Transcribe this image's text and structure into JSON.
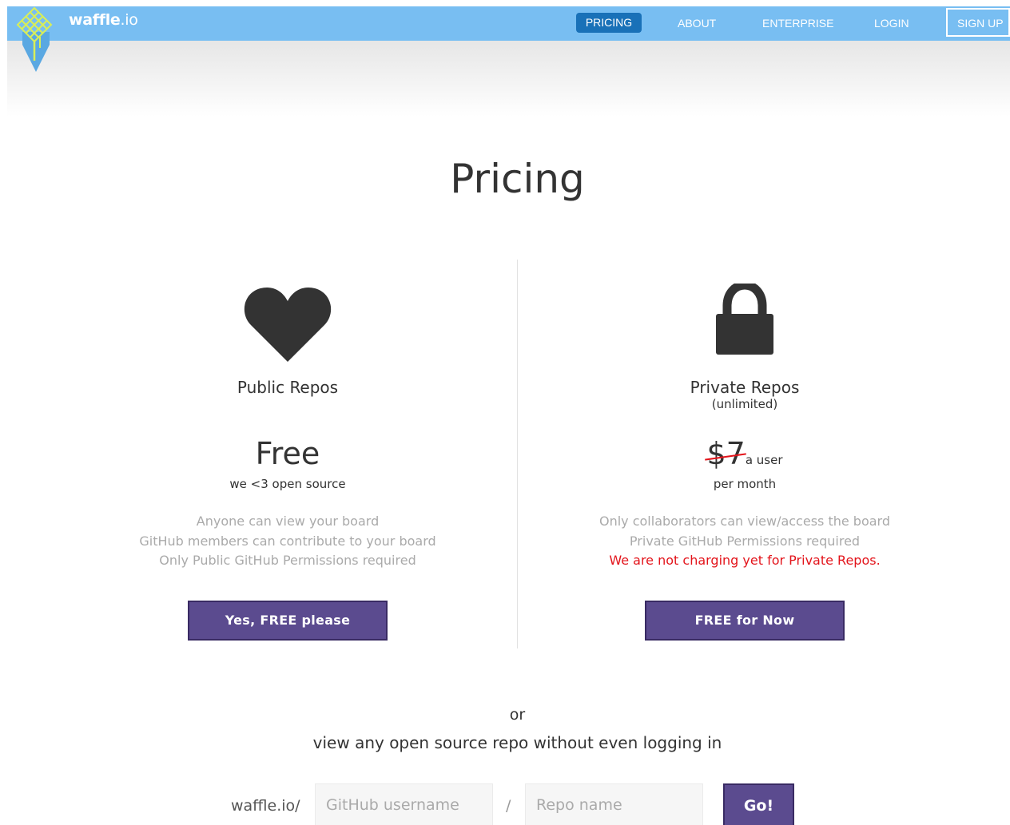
{
  "brand": {
    "name_bold": "waffle",
    "name_suffix": ".io",
    "accent": "#78bef2",
    "logo_color": "#d8ee58"
  },
  "nav": {
    "pricing": "PRICING",
    "about": "ABOUT",
    "enterprise": "ENTERPRISE",
    "login": "LOGIN",
    "signup": "SIGN UP"
  },
  "page": {
    "title": "Pricing"
  },
  "plans": {
    "public": {
      "icon": "heart-icon",
      "name": "Public Repos",
      "price": "Free",
      "price_note": "we <3 open source",
      "features": [
        "Anyone can view your board",
        "GitHub members can contribute to your board",
        "Only Public GitHub Permissions required"
      ],
      "button": "Yes, FREE please"
    },
    "private": {
      "icon": "lock-icon",
      "name": "Private Repos",
      "subtitle": "(unlimited)",
      "price": "$7",
      "price_unit": "a user",
      "price_note": "per month",
      "features": [
        "Only collaborators can view/access the board",
        "Private GitHub Permissions required"
      ],
      "warning": "We are not charging yet for Private Repos.",
      "button": "FREE for Now"
    }
  },
  "browse": {
    "or": "or",
    "text": "view any open source repo without even logging in",
    "prefix": "waffle.io/",
    "username_placeholder": "GitHub username",
    "separator": "/",
    "repo_placeholder": "Repo name",
    "go": "Go!"
  },
  "colors": {
    "button": "#5b4b8f",
    "nav_active": "#1971b8",
    "warning": "#e3141b"
  }
}
